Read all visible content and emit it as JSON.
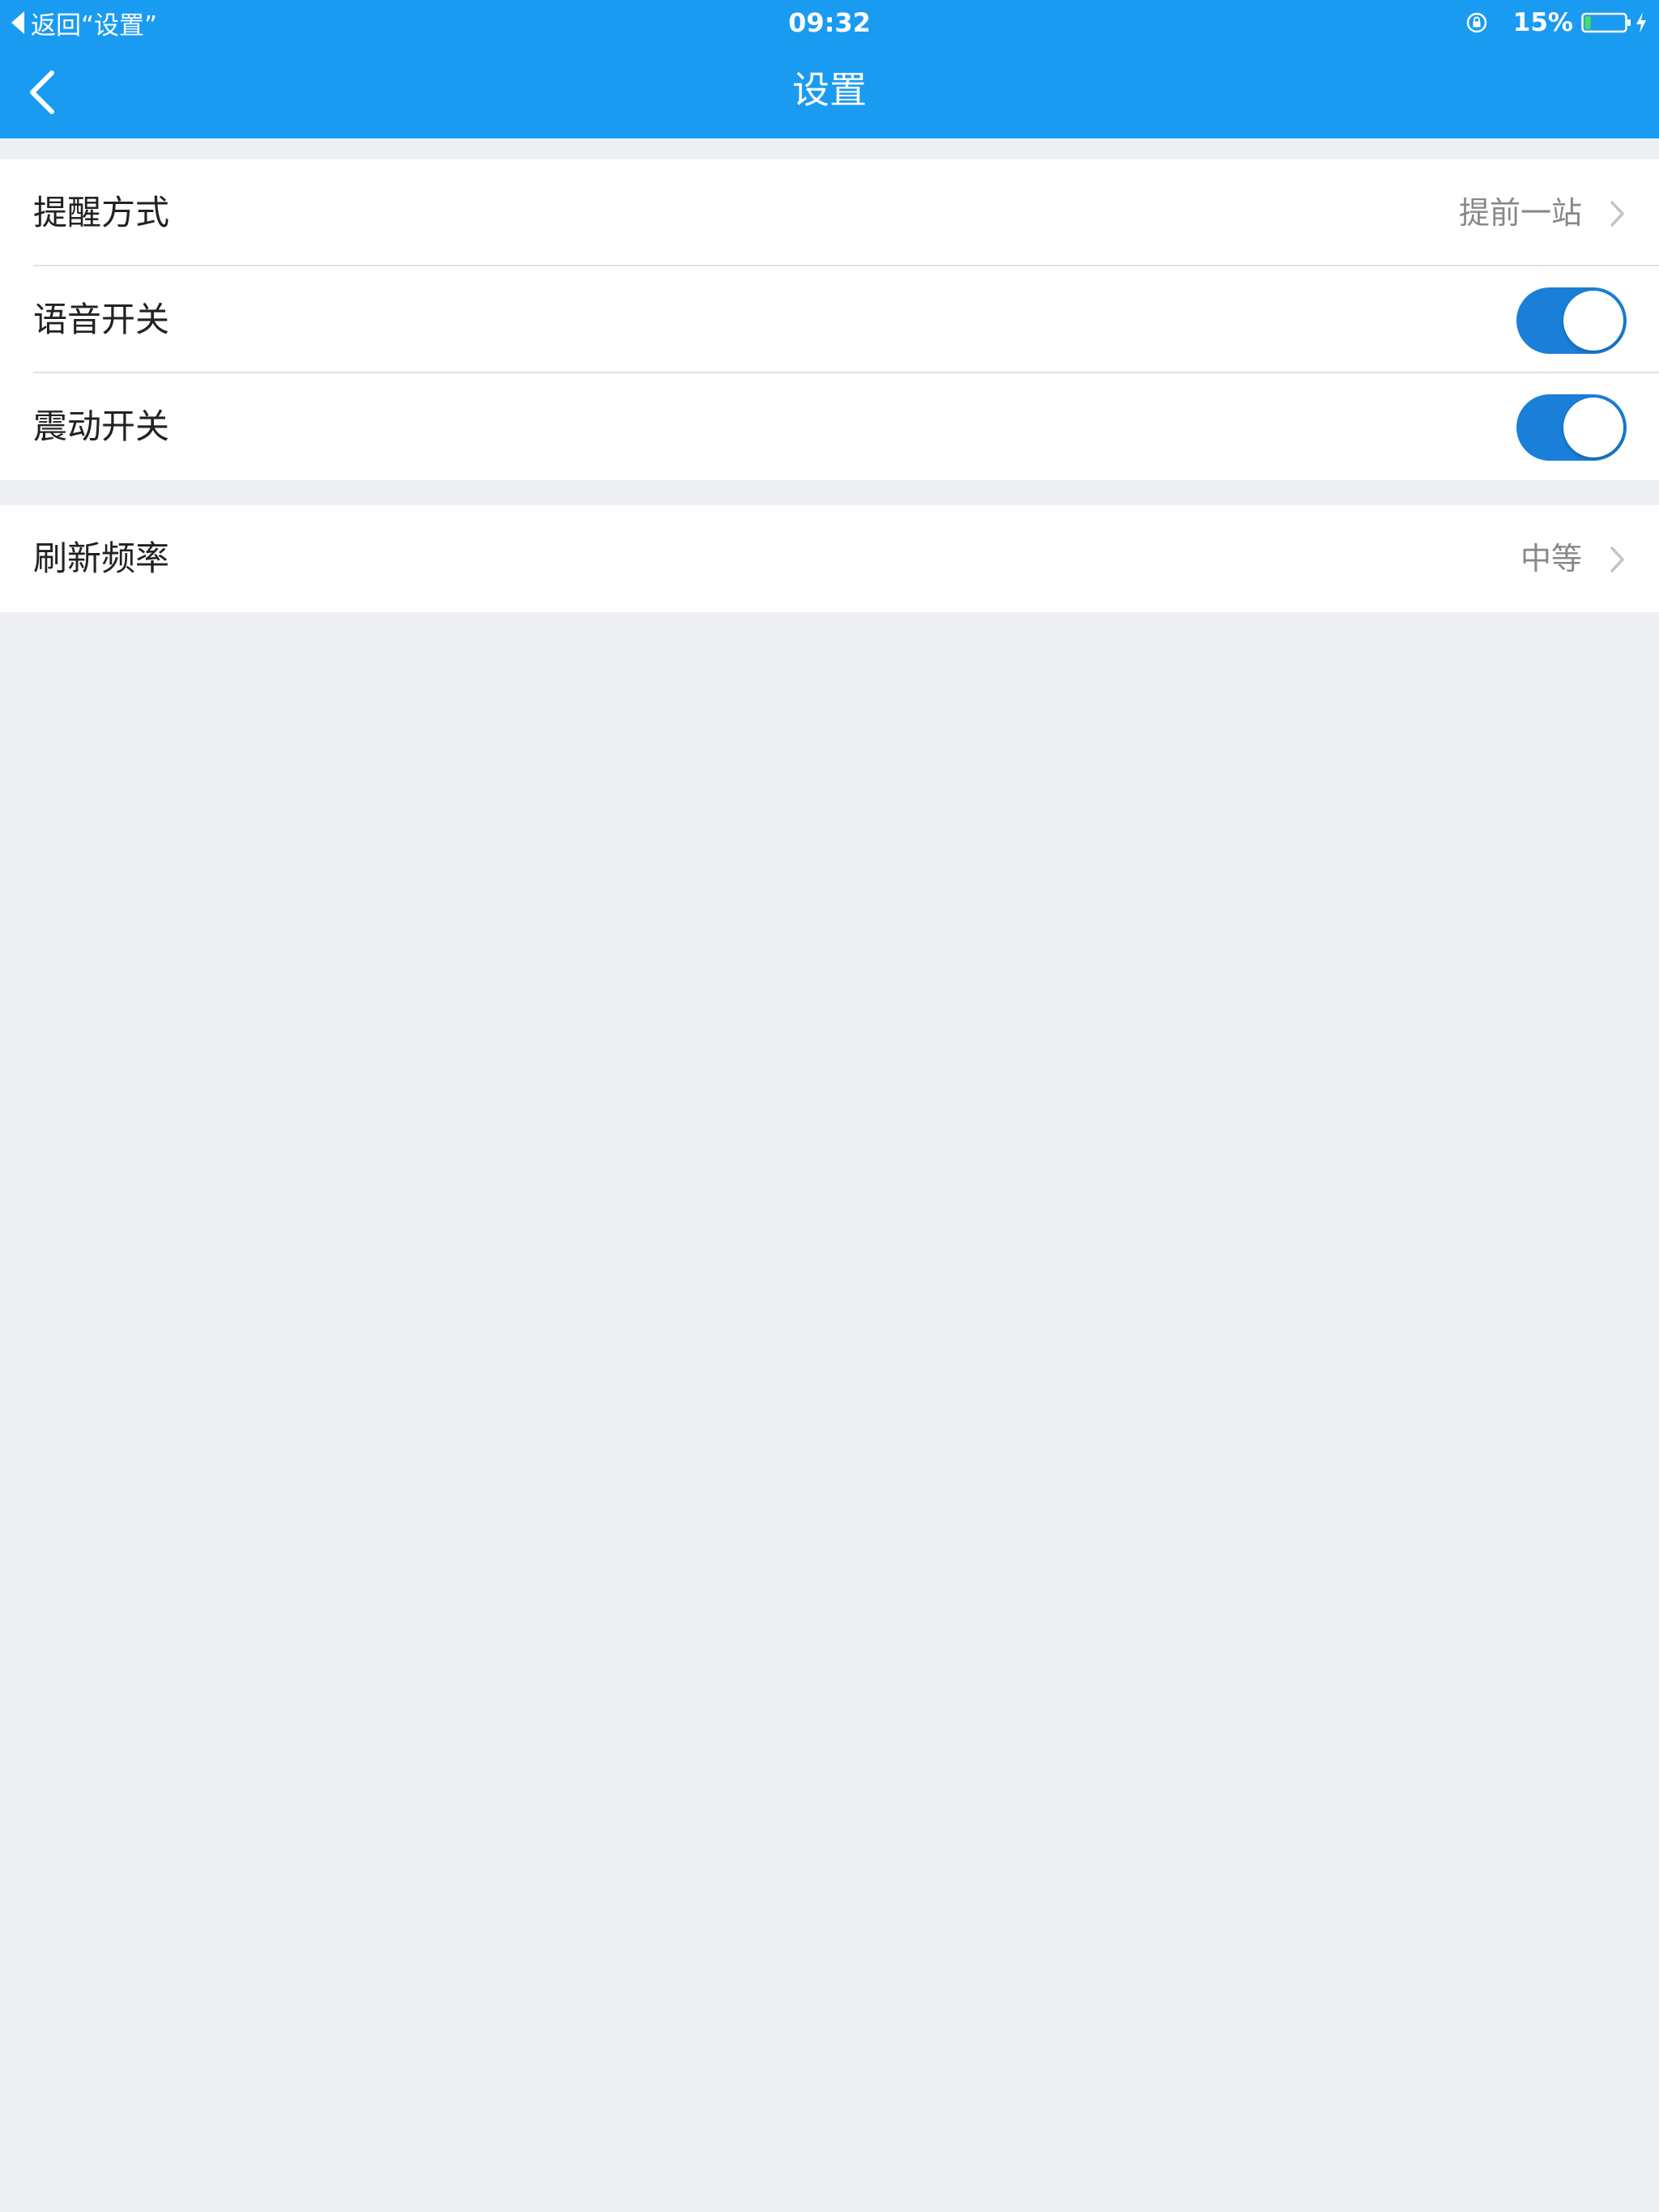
{
  "status_bar": {
    "back_text": "返回“设置”",
    "time": "09:32",
    "battery_percent": "15%",
    "battery_level": 0.15
  },
  "nav": {
    "title": "设置"
  },
  "settings": {
    "group1": {
      "reminder": {
        "label": "提醒方式",
        "value": "提前一站"
      },
      "voice": {
        "label": "语音开关",
        "on": true
      },
      "vibration": {
        "label": "震动开关",
        "on": true
      }
    },
    "group2": {
      "refresh": {
        "label": "刷新频率",
        "value": "中等"
      }
    }
  },
  "colors": {
    "header": "#1a9bf2",
    "toggle_on": "#1a7fd8",
    "background": "#eeeff3"
  }
}
